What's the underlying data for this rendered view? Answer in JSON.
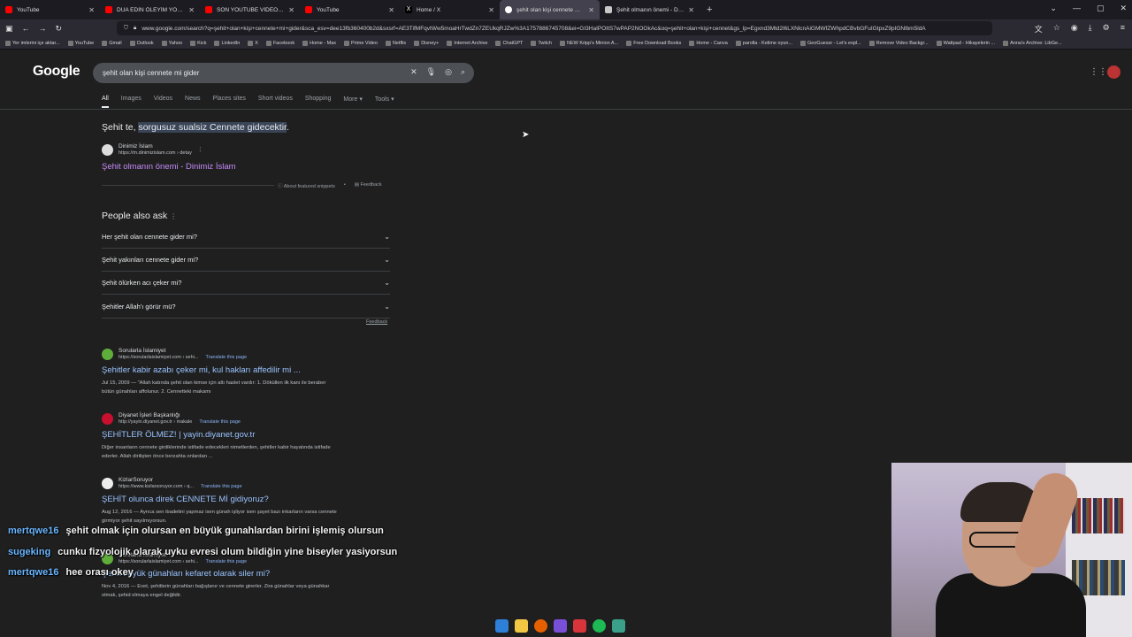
{
  "browser": {
    "tabs": [
      {
        "title": "YouTube",
        "icon": "youtube-icon",
        "active": false
      },
      {
        "title": "DUA EDİN ÖLEYİM YOKSA ÇOK",
        "icon": "youtube-icon",
        "active": false
      },
      {
        "title": "SON YOUTUBE VİDEOM - YouT...",
        "icon": "youtube-icon",
        "active": false
      },
      {
        "title": "YouTube",
        "icon": "youtube-icon",
        "active": false
      },
      {
        "title": "Home / X",
        "icon": "x-icon",
        "active": false
      },
      {
        "title": "şehit olan kişi cennete mi gider",
        "icon": "google-icon",
        "active": true
      },
      {
        "title": "Şehit olmanın önemi - Dinimiz",
        "icon": "dinimiz-icon",
        "active": false
      }
    ],
    "url": "www.google.com/search?q=şehit+olan+kişi+cennete+mi+gider&sca_esv=dee13fb360400b2d&sxsrf=AE3TifMFqvtWw5moaHrTwdZn7ZEUkqRJZw%3A1757886745708&ei=GI3HaIPOItS7wPAP2NOOkAc&oq=şehit+olan+kişi+cennet&gs_lp=Egxnd3Mtd2l6LXNlcnAiGMWfZWhpdCBvbGFuIGtpxZ9pIGNlbm5ldA",
    "bookmarks": [
      "Yer imlerini içe aktar...",
      "YouTube",
      "Gmail",
      "Outlook",
      "Yahoo",
      "Kick",
      "LinkedIn",
      "X",
      "Facebook",
      "Home - Max",
      "Prime Video",
      "Netflix",
      "Disney+",
      "Internet Archive",
      "ChatGPT",
      "Twitch",
      "NEW Kripp's Minion A...",
      "Free Download Books",
      "Home - Canva",
      "parolla - Kelime oyun...",
      "GeoGuessr - Let's expl...",
      "Remove Video Backgr...",
      "Wattpad - Hikayelerin ...",
      "Anna's Archive: LibGe..."
    ]
  },
  "google": {
    "logo": "Google",
    "query": "şehit olan kişi cennete mi gider",
    "tabs": [
      "All",
      "Images",
      "Videos",
      "News",
      "Places sites",
      "Short videos",
      "Shopping",
      "More",
      "Tools"
    ],
    "snippet": {
      "prefix": "Şehit te, ",
      "highlight": "sorgusuz sualsiz Cennete gidecektir",
      "suffix": ".",
      "source_name": "Dinimiz İslam",
      "source_url": "https://m.dinimizislam.com › detay",
      "link": "Şehit olmanın önemi - Dinimiz İslam",
      "about": "About featured snippets",
      "feedback": "Feedback"
    },
    "paa": {
      "title": "People also ask",
      "questions": [
        "Her şehit olan cennete gider mi?",
        "Şehit yakınları cennete gider mi?",
        "Şehit ölürken acı çeker mi?",
        "Şehitler Allah'ı görür mü?"
      ],
      "feedback": "Feedback"
    },
    "results": [
      {
        "site": "Sorularla İslamiyet",
        "url": "https://sorularlaislamiyet.com › sehi...",
        "translate": "Translate this page",
        "title": "Şehitler kabir azabı çeker mi, kul hakları affedilir mi ...",
        "line1": "Jul 15, 2009 — \"Allah katında şehit olan kimse için altı haslet vardır: 1. Döküllen ilk kanı ile beraber",
        "line2": "bütün günahları affolunur. 2. Cennetteki makamı"
      },
      {
        "site": "Diyanet İşleri Başkanlığı",
        "url": "http://yayin.diyanet.gov.tr › makale",
        "translate": "Translate this page",
        "title": "ŞEHİTLER ÖLMEZ! | yayin.diyanet.gov.tr",
        "line1": "Diğer insanların cennete girdiklerinde istifade edecekleri nimetlerden, şehitler kabir hayatında istifade",
        "line2": "ederler. Allah dirilişten önce berzahta onlardan ..."
      },
      {
        "site": "KizlarSoruyor",
        "url": "https://www.kizlarsoruyor.com › q...",
        "translate": "Translate this page",
        "title": "ŞEHİT olunca direk CENNETE Mİ gidiyoruz?",
        "line1": "Aug 12, 2016 — Ayrıca sen ibadetini yapmaz isen günah işliyor isen şayet bazı inkarların varsa cennete",
        "line2": "girmiyor şehit sayılmıyorsun."
      },
      {
        "site": "Sorularla İslamiyet",
        "url": "https://sorularlaislamiyet.com › sehi...",
        "translate": "Translate this page",
        "title": "Şehit büyük günahları kefaret olarak siler mi?",
        "line1": "Nov 4, 2016 — Evet, şehitlerin günahları bağışlanır ve cennete girerler. Zira günahlar veya günahkar",
        "line2": "olmak, şehid olmaya engel değildir."
      }
    ]
  },
  "chat": [
    {
      "user": "mertqwe16",
      "msg": "şehit olmak için olursan en büyük gunahlardan birini işlemiş olursun"
    },
    {
      "user": "sugeking",
      "msg": "cunku fizyolojik olarak uyku evresi olum bildiğin yine biseyler yasiyorsun"
    },
    {
      "user": "mertqwe16",
      "msg": "hee orası okey"
    }
  ],
  "colors": {
    "chat_user": "#6ab6ff",
    "link": "#99c3ff",
    "visited": "#c58af9",
    "highlight": "#394457"
  }
}
